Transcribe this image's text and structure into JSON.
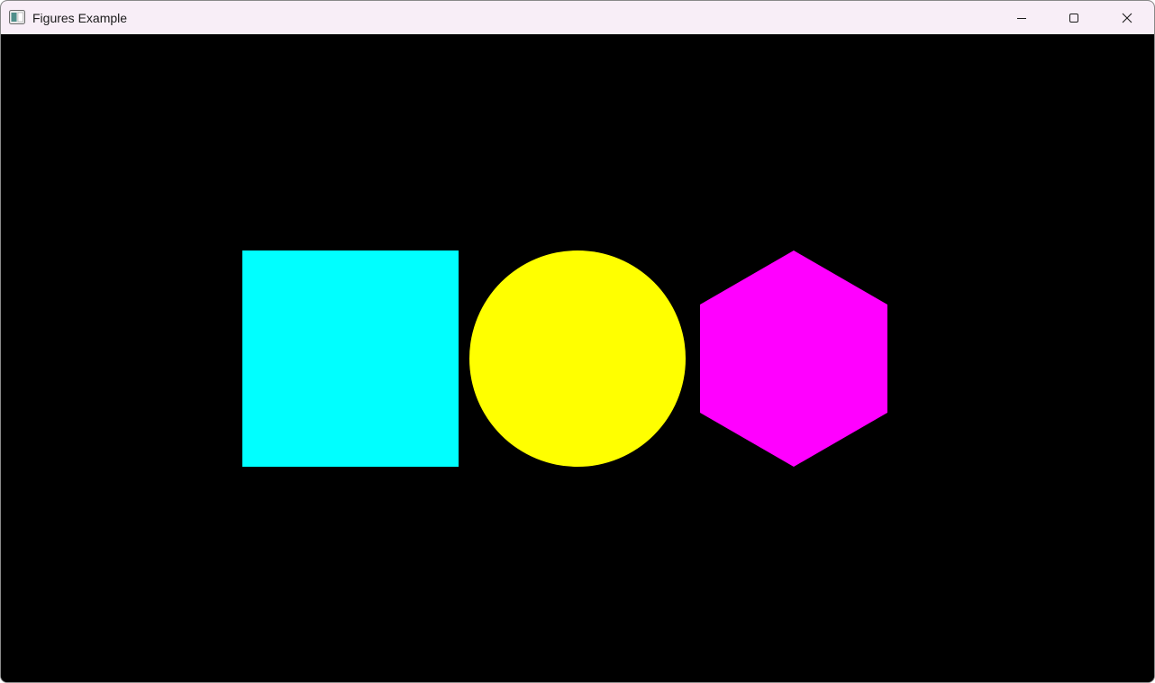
{
  "window": {
    "title": "Figures Example",
    "titlebar_color": "#f8eef7"
  },
  "icons": {
    "app": "app-window-icon",
    "minimize": "minimize-icon",
    "maximize": "maximize-icon",
    "close": "close-icon"
  },
  "canvas": {
    "background": "#000000",
    "figures": [
      {
        "shape": "square",
        "color": "#00ffff"
      },
      {
        "shape": "circle",
        "color": "#ffff00"
      },
      {
        "shape": "hexagon",
        "color": "#ff00ff"
      }
    ]
  }
}
